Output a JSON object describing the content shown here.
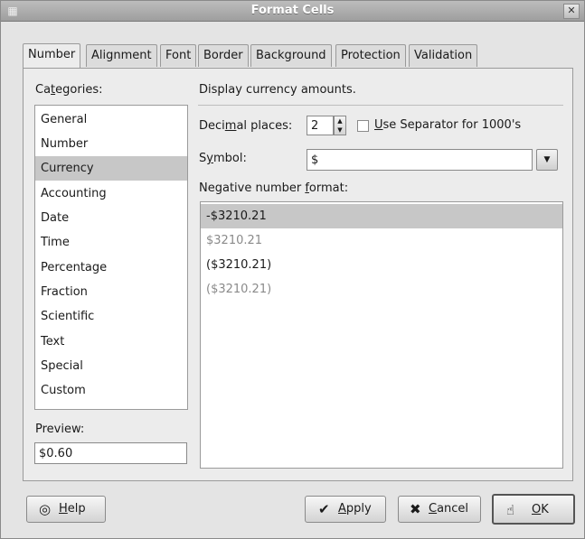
{
  "window": {
    "title": "Format Cells",
    "icon": "app-icon",
    "close_icon": "close-icon"
  },
  "tabs": [
    {
      "label": "Number"
    },
    {
      "label": "Alignment"
    },
    {
      "label": "Font"
    },
    {
      "label": "Border"
    },
    {
      "label": "Background"
    },
    {
      "label": "Protection"
    },
    {
      "label": "Validation"
    }
  ],
  "categories": {
    "label_pre": "Ca",
    "label_u": "t",
    "label_post": "egories:",
    "items": [
      "General",
      "Number",
      "Currency",
      "Accounting",
      "Date",
      "Time",
      "Percentage",
      "Fraction",
      "Scientific",
      "Text",
      "Special",
      "Custom"
    ],
    "selected": "Currency"
  },
  "preview": {
    "label": "Preview:",
    "value": "$0.60"
  },
  "description": "Display currency amounts.",
  "decimal": {
    "label_pre": "Deci",
    "label_u": "m",
    "label_post": "al places:",
    "value": "2"
  },
  "separator": {
    "checked": false,
    "label_u": "U",
    "label_post": "se Separator for 1000's"
  },
  "symbol": {
    "label_pre": "S",
    "label_u": "y",
    "label_post": "mbol:",
    "value": "$"
  },
  "negative": {
    "label_pre": "Negative number ",
    "label_u": "f",
    "label_post": "ormat:",
    "items": [
      {
        "text": "-$3210.21",
        "dim": false,
        "selected": true
      },
      {
        "text": "$3210.21",
        "dim": true,
        "selected": false
      },
      {
        "text": "($3210.21)",
        "dim": false,
        "selected": false
      },
      {
        "text": "($3210.21)",
        "dim": true,
        "selected": false
      }
    ]
  },
  "buttons": {
    "help": {
      "u": "H",
      "rest": "elp",
      "icon": "lifebuoy-icon"
    },
    "apply": {
      "u": "A",
      "rest": "pply",
      "icon": "checkmark-icon"
    },
    "cancel": {
      "u": "C",
      "rest": "ancel",
      "icon": "cross-icon"
    },
    "ok": {
      "u": "O",
      "rest": "K",
      "icon": "ok-hand-icon"
    }
  }
}
